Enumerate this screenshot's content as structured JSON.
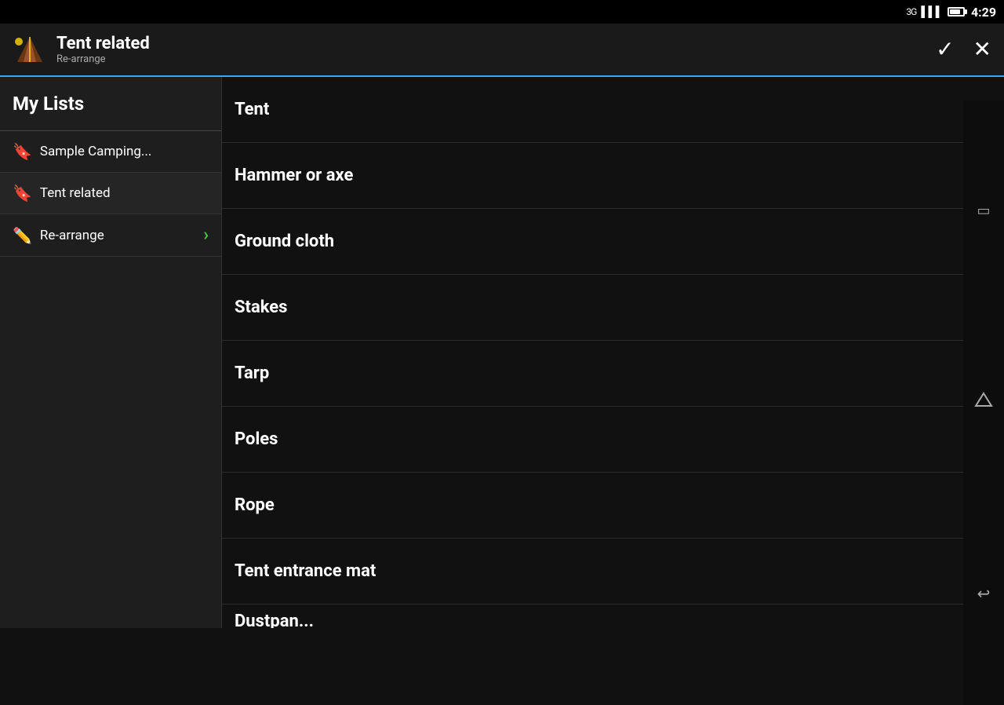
{
  "statusBar": {
    "network": "3G",
    "time": "4:29"
  },
  "appBar": {
    "title": "Tent related",
    "subtitle": "Re-arrange",
    "confirmLabel": "✓",
    "closeLabel": "✕"
  },
  "sidebar": {
    "header": "My Lists",
    "items": [
      {
        "id": "sample-camping",
        "icon": "📁",
        "label": "Sample Camping...",
        "active": false
      },
      {
        "id": "tent-related",
        "icon": "📁",
        "label": "Tent related",
        "active": true
      },
      {
        "id": "re-arrange",
        "icon": "✏️",
        "label": "Re-arrange",
        "hasChevron": true
      }
    ]
  },
  "listItems": [
    {
      "id": "tent",
      "label": "Tent"
    },
    {
      "id": "hammer-or-axe",
      "label": "Hammer or axe"
    },
    {
      "id": "ground-cloth",
      "label": "Ground cloth"
    },
    {
      "id": "stakes",
      "label": "Stakes"
    },
    {
      "id": "tarp",
      "label": "Tarp"
    },
    {
      "id": "poles",
      "label": "Poles"
    },
    {
      "id": "rope",
      "label": "Rope"
    },
    {
      "id": "tent-entrance-mat",
      "label": "Tent entrance mat"
    },
    {
      "id": "dustpan",
      "label": "Dustpan..."
    }
  ],
  "androidNav": {
    "icons": [
      "□",
      "⌂",
      "↩"
    ]
  }
}
